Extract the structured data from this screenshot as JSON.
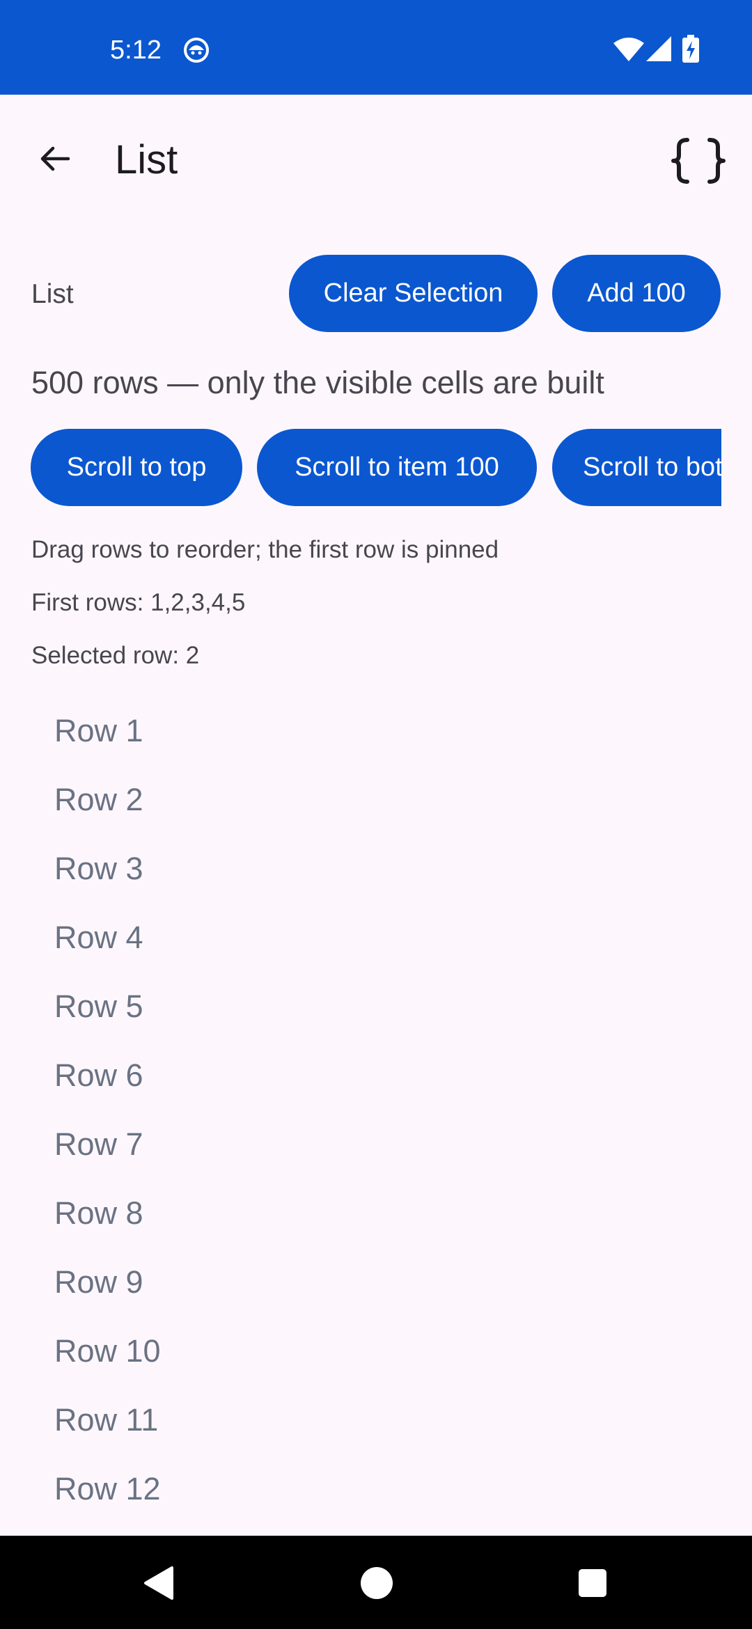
{
  "status_bar": {
    "time": "5:12",
    "background": "#0B57D0"
  },
  "app_bar": {
    "title": "List",
    "back_icon": "arrow-back-icon",
    "action_icon": "code-braces-icon"
  },
  "controls": {
    "section_label": "List",
    "clear_selection_label": "Clear Selection",
    "add_100_label": "Add 100"
  },
  "summary": "500 rows — only the visible cells are built",
  "scroll_buttons": {
    "top_label": "Scroll to top",
    "item100_label": "Scroll to item 100",
    "bottom_label": "Scroll to bottom"
  },
  "info": {
    "drag_hint": "Drag rows to reorder; the first row is pinned",
    "first_rows": "First rows: 1,2,3,4,5",
    "selected_row": "Selected row: 2"
  },
  "rows": [
    "Row 1",
    "Row 2",
    "Row 3",
    "Row 4",
    "Row 5",
    "Row 6",
    "Row 7",
    "Row 8",
    "Row 9",
    "Row 10",
    "Row 11",
    "Row 12"
  ],
  "colors": {
    "accent": "#0B57D0",
    "background": "#FDF7FD",
    "row_text": "#6A7282"
  }
}
